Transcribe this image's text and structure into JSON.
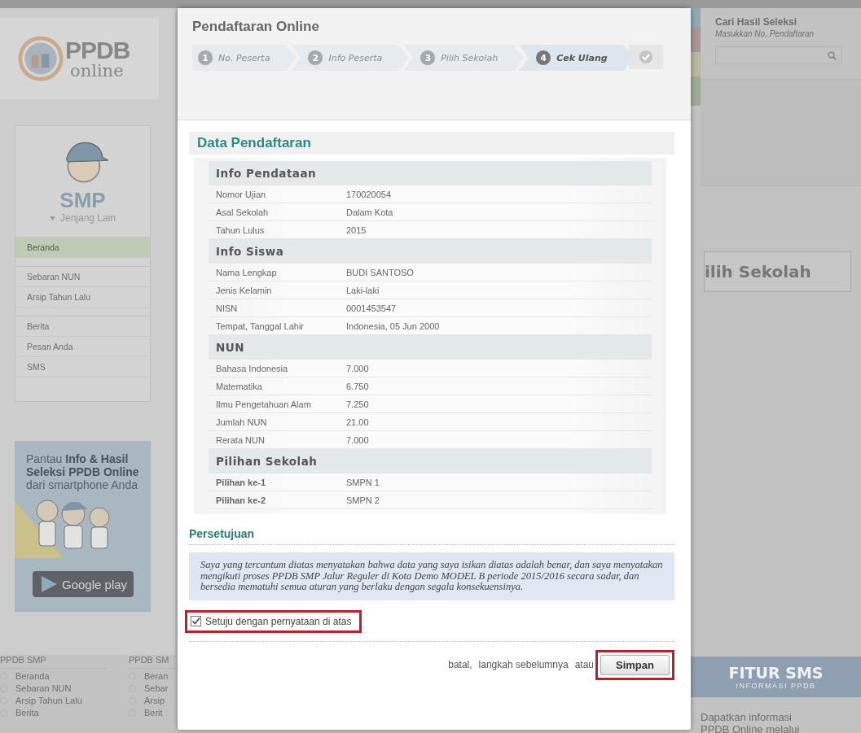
{
  "page": {
    "logo": {
      "title": "PPDB",
      "subtitle": "online"
    },
    "sidebar": {
      "level": "SMP",
      "switch": "Jenjang Lain",
      "menu_groups": [
        {
          "items": [
            {
              "label": "Beranda",
              "selected": true
            }
          ]
        },
        {
          "items": [
            {
              "label": "Sebaran NUN",
              "selected": false
            },
            {
              "label": "Arsip Tahun Lalu",
              "selected": false
            }
          ]
        },
        {
          "items": [
            {
              "label": "Berita",
              "selected": false
            },
            {
              "label": "Pesan Anda",
              "selected": false
            },
            {
              "label": "SMS",
              "selected": false
            }
          ]
        }
      ]
    },
    "promo": {
      "text": "Pantau **Info & Hasil Seleksi PPDB Online** dari smartphone Anda",
      "store": "Google play"
    },
    "search": {
      "title": "Cari Hasil Seleksi",
      "subtitle": "Masukkan No. Pendaftaran"
    },
    "main_button": "ilih Sekolah",
    "sms": {
      "title": "FITUR SMS",
      "subtitle": "INFORMASI PPDB",
      "text": "Dapatkan informasi PPDB Online melalui"
    },
    "footer": [
      {
        "title": "PPDB SMP",
        "items": [
          "Beranda",
          "Sebaran NUN",
          "Arsip Tahun Lalu",
          "Berita"
        ]
      },
      {
        "title": "PPDB SM",
        "items": [
          "Beran",
          "Sebar",
          "Arsip",
          "Berit"
        ]
      }
    ]
  },
  "dialog": {
    "title": "Pendaftaran Online",
    "steps": [
      {
        "kind": "numbered",
        "number": "1",
        "label": "No. Peserta",
        "selected": false
      },
      {
        "kind": "numbered",
        "number": "2",
        "label": "Info Peserta",
        "selected": false
      },
      {
        "kind": "numbered",
        "number": "3",
        "label": "Pilih Sekolah",
        "selected": false
      },
      {
        "kind": "numbered",
        "number": "4",
        "label": "Cek Ulang",
        "selected": true
      },
      {
        "kind": "finish",
        "selected": false
      }
    ],
    "section_title": "Data Pendaftaran",
    "groups": [
      {
        "title": "Info Pendataan",
        "bold_labels": false,
        "rows": [
          {
            "label": "Nomor Ujian",
            "value": "170020054"
          },
          {
            "label": "Asal Sekolah",
            "value": "Dalam Kota"
          },
          {
            "label": "Tahun Lulus",
            "value": "2015"
          }
        ]
      },
      {
        "title": "Info Siswa",
        "bold_labels": false,
        "rows": [
          {
            "label": "Nama Lengkap",
            "value": "BUDI SANTOSO"
          },
          {
            "label": "Jenis Kelamin",
            "value": "Laki-laki"
          },
          {
            "label": "NISN",
            "value": "0001453547"
          },
          {
            "label": "Tempat, Tanggal Lahir",
            "value": "Indonesia, 05 Jun 2000"
          }
        ]
      },
      {
        "title": "NUN",
        "bold_labels": false,
        "rows": [
          {
            "label": "Bahasa Indonesia",
            "value": "7.000"
          },
          {
            "label": "Matematika",
            "value": "6.750"
          },
          {
            "label": "Ilmu Pengetahuan Alam",
            "value": "7.250"
          },
          {
            "label": "Jumlah NUN",
            "value": "21.00"
          },
          {
            "label": "Rerata NUN",
            "value": "7.000"
          }
        ]
      },
      {
        "title": "Pilihan Sekolah",
        "bold_labels": true,
        "rows": [
          {
            "label": "Pilihan ke-1",
            "value": "SMPN 1"
          },
          {
            "label": "Pilihan ke-2",
            "value": "SMPN 2"
          }
        ]
      }
    ],
    "agreement": {
      "title": "Persetujuan",
      "text": "Saya yang tercantum diatas menyatakan bahwa data yang saya isikan diatas adalah benar, dan saya menyatakan mengikuti proses PPDB SMP Jalur Reguler di Kota Demo MODEL B periode 2015/2016 secara sadar, dan bersedia mematuhi semua aturan yang berlaku dengan segala konsekuensinya.",
      "checkbox": {
        "label": "Setuju dengan pernyataan di atas",
        "checked": true,
        "highlighted": true
      }
    },
    "actions": {
      "cancel": "batal,",
      "back": "langkah sebelumnya",
      "or": "atau",
      "save": {
        "label": "Simpan",
        "highlighted": true
      }
    }
  }
}
